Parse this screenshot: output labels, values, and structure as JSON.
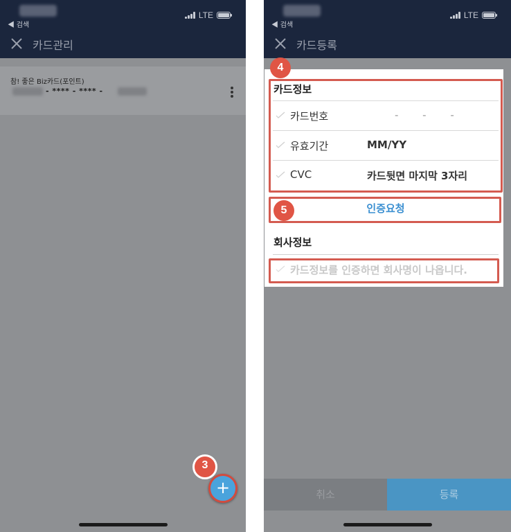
{
  "colors": {
    "header": "#1b263d",
    "accent": "#4aa3dc",
    "highlight": "#d45b50",
    "badge": "#e05545"
  },
  "status": {
    "back": "◀ 검색",
    "network": "LTE"
  },
  "left": {
    "nav": {
      "title": "카드관리",
      "close_icon": "close-icon"
    },
    "card": {
      "name": "참! 좋은 Biz카드(포인트)",
      "number_mask": "- **** - **** -"
    },
    "fab_label": "+",
    "badge": "3"
  },
  "right": {
    "nav": {
      "title": "카드등록",
      "close_icon": "close-icon"
    },
    "badges": {
      "card_info": "4",
      "verify": "5"
    },
    "card_section": {
      "title": "카드정보",
      "rows": [
        {
          "label": "카드번호",
          "value": "- - -"
        },
        {
          "label": "유효기간",
          "value": "MM/YY"
        },
        {
          "label": "CVC",
          "value": "카드뒷면 마지막 3자리"
        }
      ]
    },
    "verify_button": "인증요청",
    "company_section": {
      "title": "회사정보",
      "placeholder": "카드정보를 인증하면 회사명이 나옵니다."
    },
    "bottom": {
      "cancel": "취소",
      "register": "등록"
    }
  }
}
